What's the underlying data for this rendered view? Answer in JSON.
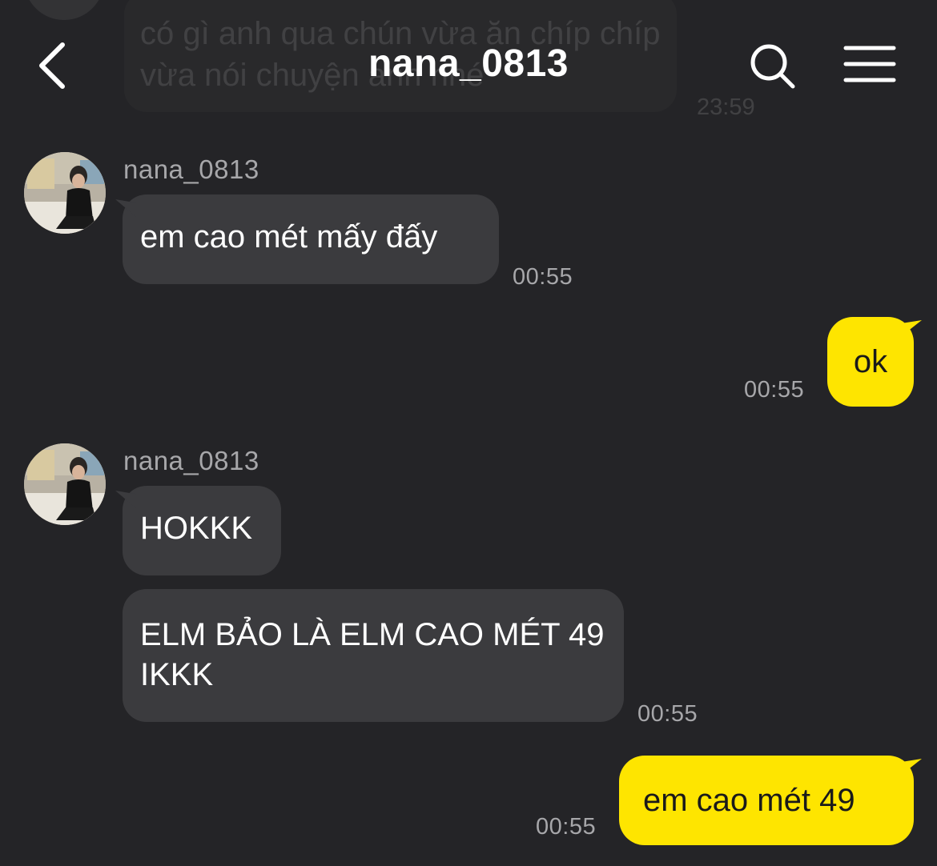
{
  "header": {
    "title": "nana_0813",
    "back_icon": "chevron-left-icon",
    "search_icon": "search-icon",
    "menu_icon": "hamburger-menu-icon"
  },
  "previous_message": {
    "text": "có gì anh qua chún vừa ăn chíp chíp vừa nói chuyện anh nhé",
    "time": "23:59"
  },
  "messages": [
    {
      "direction": "incoming",
      "sender": "nana_0813",
      "text": "em cao mét mấy đấy",
      "time": "00:55"
    },
    {
      "direction": "outgoing",
      "text": "ok",
      "time": "00:55"
    },
    {
      "direction": "incoming",
      "sender": "nana_0813",
      "text": "HOKKK"
    },
    {
      "direction": "incoming",
      "text": "ELM BẢO LÀ ELM CAO MÉT 49 IKKK",
      "time": "00:55"
    },
    {
      "direction": "outgoing",
      "text": "em cao mét 49",
      "time": "00:55"
    }
  ],
  "colors": {
    "background": "#242427",
    "incoming_bubble": "#3b3b3e",
    "outgoing_bubble": "#fee500",
    "secondary_text": "#a7a7aa"
  }
}
